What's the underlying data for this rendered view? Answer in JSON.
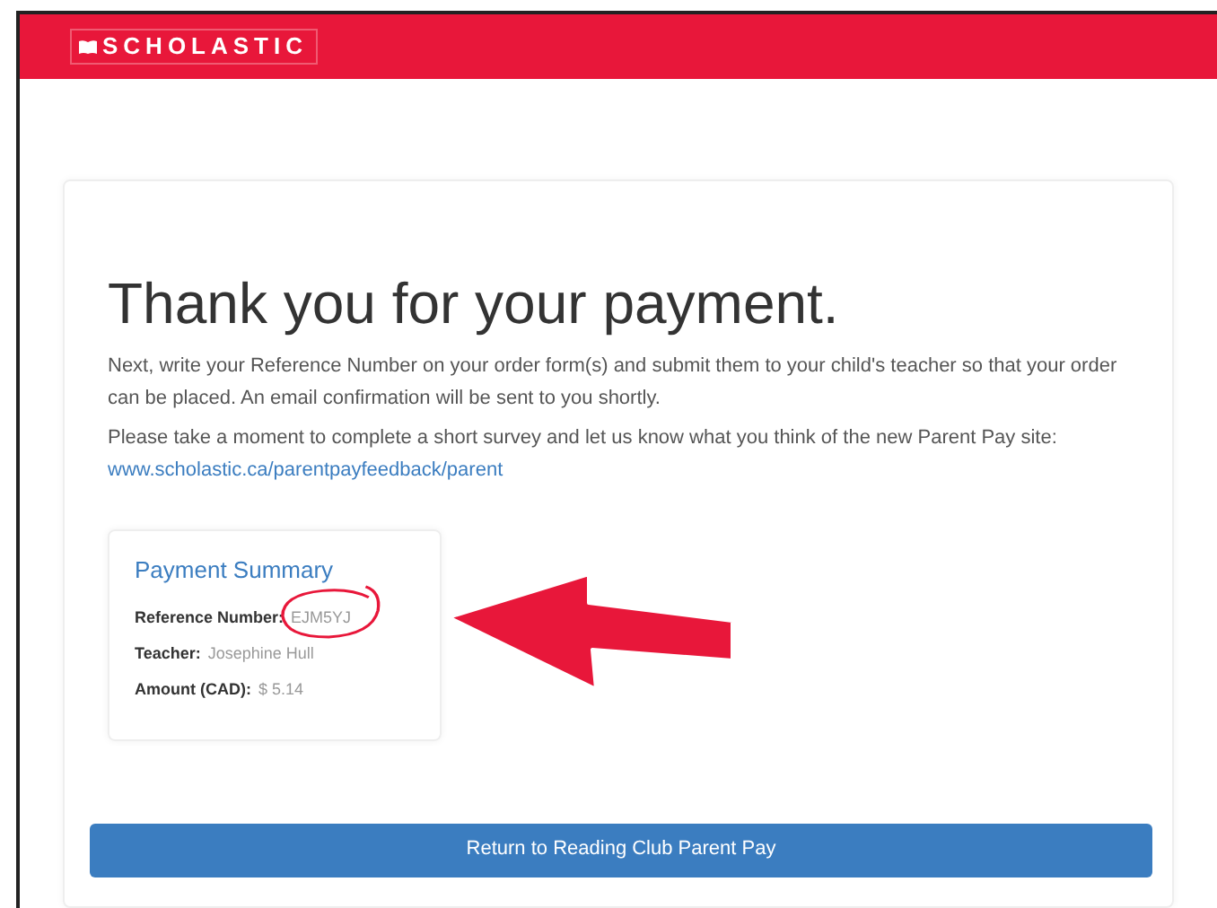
{
  "header": {
    "logo": "SCHOLASTIC"
  },
  "confirmation": {
    "title": "Thank you for your payment.",
    "paragraphs": [
      {
        "text": "Next, write your Reference Number on your order form(s) and submit them to your child's teacher so that your order can be placed. An email confirmation will be sent to you shortly."
      },
      {
        "text": "Please take a moment to complete a short survey and let us know what you think of the new Parent Pay site:",
        "link": "www.scholastic.ca/parentpayfeedback/parent"
      }
    ],
    "summary": {
      "title": "Payment Summary",
      "fields": [
        {
          "label": "Reference Number:",
          "value": "EJM5YJ"
        },
        {
          "label": "Teacher:",
          "value": "Josephine Hull"
        },
        {
          "label": "Amount (CAD):",
          "value": "$ 5.14"
        }
      ]
    },
    "button": "Return to Reading Club Parent Pay"
  }
}
